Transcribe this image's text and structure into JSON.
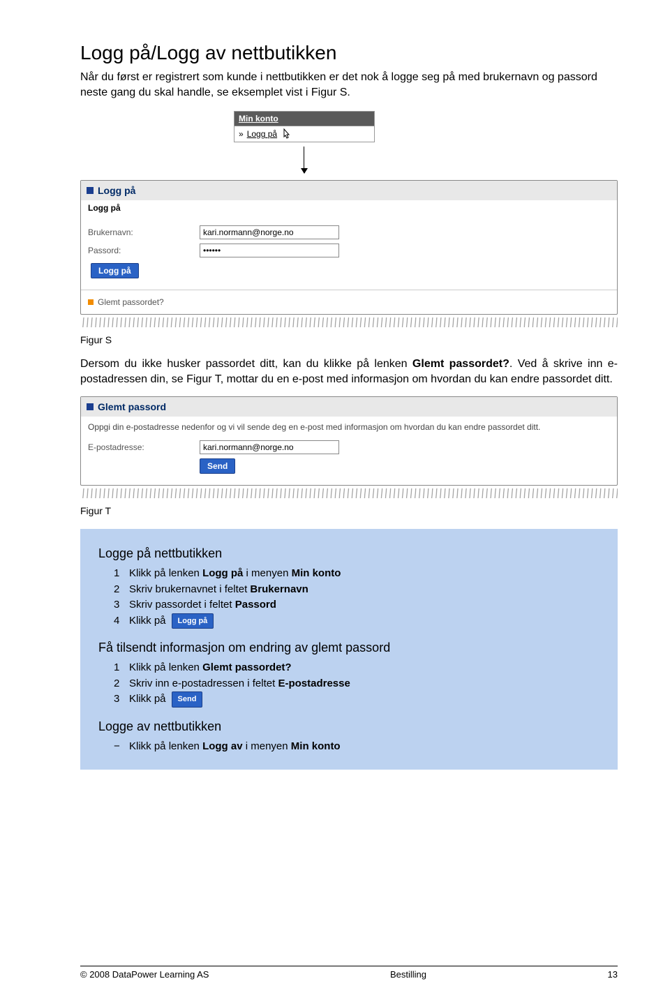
{
  "heading": "Logg på/Logg av nettbutikken",
  "intro": "Når du først er registrert som kunde i nettbutikken er det nok å logge seg på med brukernavn og passord neste gang du skal handle, se eksemplet vist i Figur S.",
  "minkonto": {
    "title": "Min konto",
    "item_prefix": "»",
    "item": "Logg på"
  },
  "login_panel": {
    "title": "Logg på",
    "subtitle": "Logg på",
    "user_label": "Brukernavn:",
    "user_value": "kari.normann@norge.no",
    "pass_label": "Passord:",
    "pass_value": "••••••",
    "button": "Logg på",
    "forgot": "Glemt passordet?"
  },
  "figS": "Figur S",
  "para2_a": "Dersom du ikke husker passordet ditt, kan du klikke på lenken ",
  "para2_b": "Glemt passordet?",
  "para2_c": ". Ved å skrive inn e-postadressen din, se Figur T, mottar du en e-post med informasjon om hvordan du kan endre passordet ditt.",
  "forgot_panel": {
    "title": "Glemt passord",
    "desc": "Oppgi din e-postadresse nedenfor og vi vil sende deg en e-post med informasjon om hvordan du kan endre passordet ditt.",
    "email_label": "E-postadresse:",
    "email_value": "kari.normann@norge.no",
    "button": "Send"
  },
  "figT": "Figur T",
  "box": {
    "h1": "Logge på nettbutikken",
    "s1_a": "Klikk på lenken ",
    "s1_b": "Logg på",
    "s1_c": " i menyen ",
    "s1_d": "Min konto",
    "s2_a": "Skriv brukernavnet i feltet ",
    "s2_b": "Brukernavn",
    "s3_a": "Skriv passordet i feltet ",
    "s3_b": "Passord",
    "s4": "Klikk på",
    "s4_btn": "Logg på",
    "h2": "Få tilsendt informasjon om endring av glemt passord",
    "t1_a": "Klikk på lenken ",
    "t1_b": "Glemt passordet?",
    "t2_a": "Skriv inn e-postadressen i feltet ",
    "t2_b": "E-postadresse",
    "t3": "Klikk på",
    "t3_btn": "Send",
    "h3": "Logge av nettbutikken",
    "u1_a": "Klikk på lenken ",
    "u1_b": "Logg av",
    "u1_c": " i menyen ",
    "u1_d": "Min konto",
    "dash": "−"
  },
  "footer": {
    "left": "© 2008 DataPower Learning AS",
    "center": "Bestilling",
    "right": "13"
  }
}
